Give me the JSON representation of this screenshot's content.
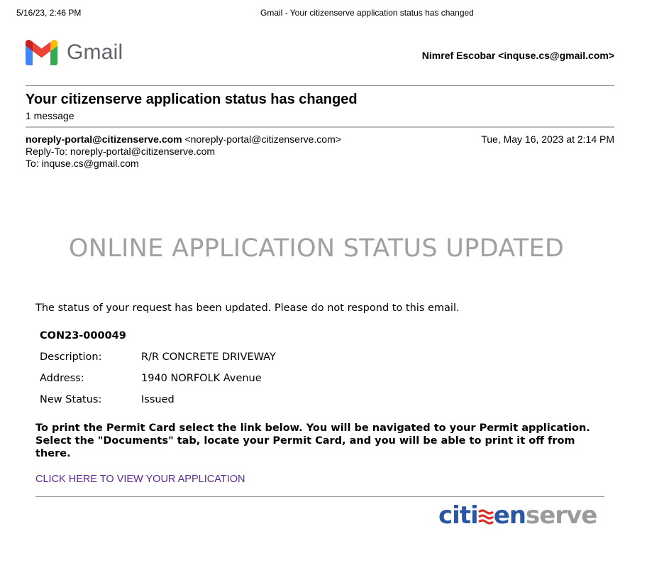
{
  "print_header": {
    "datetime": "5/16/23, 2:46 PM",
    "page_title": "Gmail - Your citizenserve application status has changed"
  },
  "gmail": {
    "logo_text": "Gmail",
    "account": "Nimref Escobar <inquse.cs@gmail.com>",
    "colors": {
      "red": "#EA4335",
      "blue": "#4285F4",
      "green": "#34A853",
      "yellow": "#FBBC04",
      "dark_red": "#C5221F"
    }
  },
  "thread": {
    "subject": "Your citizenserve application status has changed",
    "message_count": "1 message"
  },
  "message": {
    "from_name": "noreply-portal@citizenserve.com",
    "from_address": "<noreply-portal@citizenserve.com>",
    "date": "Tue, May 16, 2023 at 2:14 PM",
    "reply_to": "Reply-To: noreply-portal@citizenserve.com",
    "to": "To: inquse.cs@gmail.com"
  },
  "email_body": {
    "banner": "ONLINE APPLICATION STATUS UPDATED",
    "intro": "The status of your request has been updated. Please do not respond to this email.",
    "permit_number": "CON23-000049",
    "details": [
      {
        "label": "Description:",
        "value": "R/R CONCRETE DRIVEWAY"
      },
      {
        "label": "Address:",
        "value": "1940 NORFOLK Avenue"
      },
      {
        "label": "New Status:",
        "value": "Issued"
      }
    ],
    "instructions": "To print the Permit Card select the link below. You will be navigated to your Permit application. Select the \"Documents\" tab, locate your Permit Card, and you will be able to print it off from there.",
    "link_text": "CLICK HERE TO VIEW YOUR APPLICATION",
    "link_color": "#5B2C8F"
  },
  "footer": {
    "brand_part1": "citi",
    "brand_part2": "en",
    "brand_part3": "serve",
    "brand_colors": {
      "blue": "#2B56A3",
      "red": "#D6332B",
      "gray": "#9A9A9A"
    }
  }
}
